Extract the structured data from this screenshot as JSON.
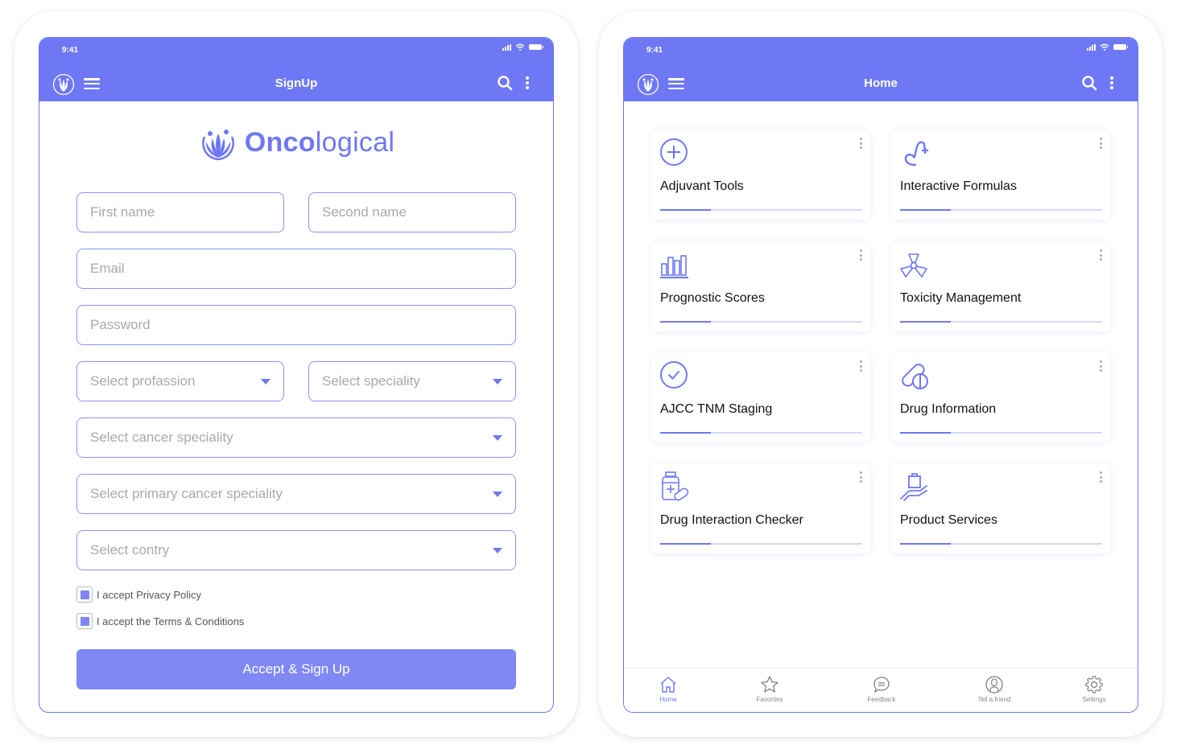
{
  "colors": {
    "accent": "#6e78f4",
    "button": "#7f88f3",
    "border": "#8a93f4",
    "placeholder": "#a9a9a9"
  },
  "signup": {
    "status_time": "9:41",
    "title": "SignUp",
    "brand": {
      "bold": "Onco",
      "light": "logical"
    },
    "fields": {
      "first_name": "First name",
      "second_name": "Second name",
      "email": "Email",
      "password": "Password",
      "profession": "Select profassion",
      "speciality": "Select speciality",
      "cancer_speciality": "Select cancer speciality",
      "primary_cancer_speciality": "Select primary cancer speciality",
      "country": "Select contry"
    },
    "checkboxes": [
      {
        "label": "I accept Privacy Policy",
        "checked": true
      },
      {
        "label": "I accept the Terms & Conditions",
        "checked": true
      }
    ],
    "submit_label": "Accept & Sign Up"
  },
  "home": {
    "status_time": "9:41",
    "title": "Home",
    "cards": [
      {
        "title": "Adjuvant Tools",
        "icon": "plus-circle-icon",
        "progress": 0.25
      },
      {
        "title": "Interactive Formulas",
        "icon": "formula-icon",
        "progress": 0.25
      },
      {
        "title": "Prognostic Scores",
        "icon": "bar-chart-icon",
        "progress": 0.25
      },
      {
        "title": "Toxicity Management",
        "icon": "radiation-icon",
        "progress": 0.25
      },
      {
        "title": "AJCC TNM Staging",
        "icon": "check-circle-icon",
        "progress": 0.25
      },
      {
        "title": "Drug Information",
        "icon": "pills-icon",
        "progress": 0.25
      },
      {
        "title": "Drug Interaction Checker",
        "icon": "medicine-bottle-icon",
        "progress": 0.25
      },
      {
        "title": "Product Services",
        "icon": "hand-bag-icon",
        "progress": 0.25
      }
    ],
    "tabs": [
      {
        "label": "Home",
        "icon": "home-icon",
        "active": true
      },
      {
        "label": "Favorites",
        "icon": "star-icon",
        "active": false
      },
      {
        "label": "Feedback",
        "icon": "chat-icon",
        "active": false
      },
      {
        "label": "Tell a friend",
        "icon": "person-icon",
        "active": false
      },
      {
        "label": "Settings",
        "icon": "gear-icon",
        "active": false
      }
    ]
  }
}
